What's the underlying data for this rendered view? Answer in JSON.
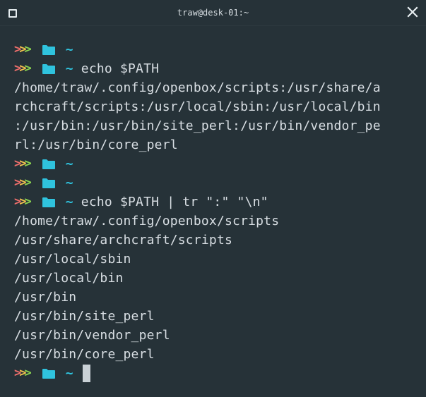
{
  "window": {
    "title": "traw@desk-01:~",
    "maximize_icon": "square-icon",
    "close_icon": "x-icon"
  },
  "prompt": {
    "chevrons": ">>>",
    "folder_icon": "folder-icon",
    "cwd": "~",
    "colors": {
      "chevron_1": "#ef6f6c",
      "chevron_2": "#f2c14e",
      "chevron_3": "#8bd450",
      "folder": "#2fc3de",
      "cwd": "#2fc3de"
    }
  },
  "lines": [
    {
      "type": "prompt",
      "command": ""
    },
    {
      "type": "prompt",
      "command": "echo $PATH"
    },
    {
      "type": "output",
      "text": "/home/traw/.config/openbox/scripts:/usr/share/a"
    },
    {
      "type": "output",
      "text": "rchcraft/scripts:/usr/local/sbin:/usr/local/bin"
    },
    {
      "type": "output",
      "text": ":/usr/bin:/usr/bin/site_perl:/usr/bin/vendor_pe"
    },
    {
      "type": "output",
      "text": "rl:/usr/bin/core_perl"
    },
    {
      "type": "prompt",
      "command": ""
    },
    {
      "type": "prompt",
      "command": ""
    },
    {
      "type": "prompt",
      "command": "echo $PATH | tr \":\" \"\\n\""
    },
    {
      "type": "output",
      "text": "/home/traw/.config/openbox/scripts"
    },
    {
      "type": "output",
      "text": "/usr/share/archcraft/scripts"
    },
    {
      "type": "output",
      "text": "/usr/local/sbin"
    },
    {
      "type": "output",
      "text": "/usr/local/bin"
    },
    {
      "type": "output",
      "text": "/usr/bin"
    },
    {
      "type": "output",
      "text": "/usr/bin/site_perl"
    },
    {
      "type": "output",
      "text": "/usr/bin/vendor_perl"
    },
    {
      "type": "output",
      "text": "/usr/bin/core_perl"
    },
    {
      "type": "prompt",
      "command": "",
      "cursor": true
    }
  ]
}
